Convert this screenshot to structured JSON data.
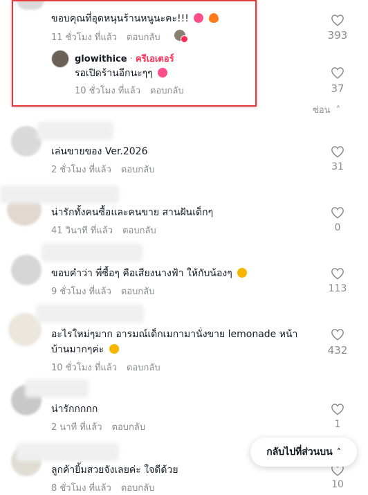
{
  "top_comment": {
    "text": "ขอบคุณที่อุดหนุนร้านหนูนะคะ!!!",
    "time": "11 ชั่วโมง ที่แล้ว",
    "reply": "ตอบกลับ",
    "likes": "393"
  },
  "creator_reply": {
    "username": "glowithice",
    "separator": "·",
    "badge": "ครีเอเตอร์",
    "text": "รอเปิดร้านอีกนะๆๆ",
    "time": "10 ชั่วโมง ที่แล้ว",
    "reply": "ตอบกลับ",
    "likes": "37"
  },
  "hide_replies": "ซ่อน",
  "comments": [
    {
      "text": "เล่นขายของ Ver.2026",
      "time": "2 ชั่วโมง ที่แล้ว",
      "reply": "ตอบกลับ",
      "likes": "31"
    },
    {
      "text": "น่ารักทั้งคนซื้อและคนขาย สานฝันเด็กๆ",
      "time": "41 วินาที ที่แล้ว",
      "reply": "ตอบกลับ",
      "likes": "0"
    },
    {
      "text": "ขอบคำว่า พี่ซื้อๆ คือเสียงนางฟ้า ให้กับน้องๆ",
      "time": "9 ชั่วโมง ที่แล้ว",
      "reply": "ตอบกลับ",
      "likes": "113"
    },
    {
      "text_line1": "อะไรใหม่ๆมาก อารมณ์เด็กเมกามานั่งขาย lemonade หน้า",
      "text_line2": "บ้านมากๆค่ะ",
      "time": "10 ชั่วโมง ที่แล้ว",
      "reply": "ตอบกลับ",
      "likes": "432"
    },
    {
      "text": "น่ารักกกกก",
      "time": "2 นาที ที่แล้ว",
      "reply": "ตอบกลับ",
      "likes": "1"
    },
    {
      "text": "ลูกค้ายิ้มสวยจังเลยค่ะ ใจดีด้วย",
      "time": "8 ชั่วโมง ที่แล้ว",
      "reply": "ตอบกลับ",
      "likes": "10"
    }
  ],
  "back_to_top": "กลับไปที่ส่วนบน",
  "colors": {
    "creator_badge": "#fe2c55",
    "highlight": "#e0393e",
    "heart_emoji": "#ff4f8b",
    "smile_emoji": "#f7b500"
  }
}
